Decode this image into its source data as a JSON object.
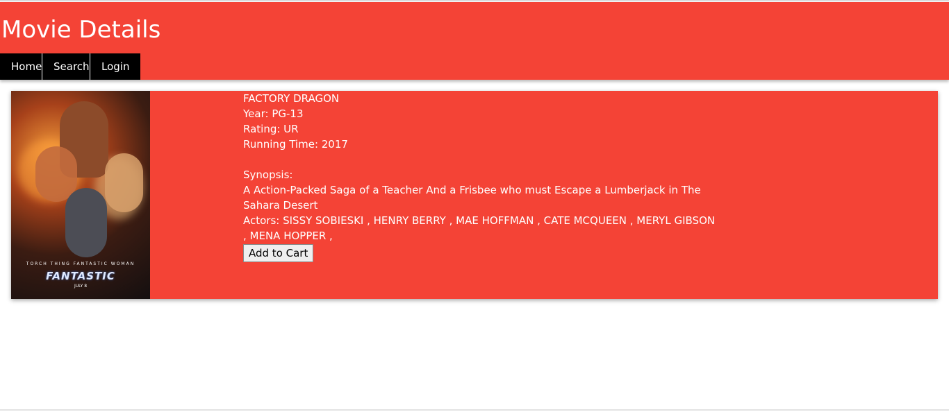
{
  "header": {
    "title": "Movie Details",
    "nav": [
      "Home",
      "Search",
      "Login"
    ]
  },
  "movie": {
    "poster": {
      "label": "FANTASTIC",
      "names": "TORCH  THING  FANTASTIC  WOMAN",
      "date": "JULY 8"
    },
    "title": "FACTORY DRAGON",
    "year": "Year: PG-13",
    "rating": "Rating: UR",
    "running_time": "Running Time: 2017",
    "synopsis_label": "Synopsis:",
    "synopsis": "A Action-Packed Saga of a Teacher And a Frisbee who must Escape a Lumberjack in The Sahara Desert",
    "actors": "Actors: SISSY SOBIESKI , HENRY BERRY , MAE HOFFMAN , CATE MCQUEEN , MERYL GIBSON , MENA HOPPER ,",
    "add_to_cart": "Add to Cart"
  },
  "colors": {
    "accent": "#f44336",
    "nav_bg": "#000000"
  }
}
